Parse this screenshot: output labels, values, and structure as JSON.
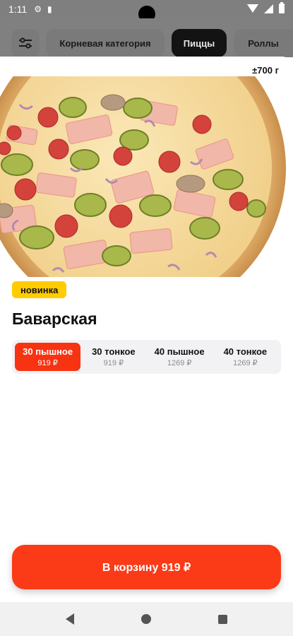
{
  "status_bar": {
    "time": "1:11",
    "icons": [
      "gear-icon",
      "sd-card-icon",
      "wifi-icon",
      "signal-icon",
      "battery-icon"
    ]
  },
  "categories": {
    "filter_icon": "sliders-icon",
    "items": [
      {
        "label": "Корневая категория",
        "active": false
      },
      {
        "label": "Пиццы",
        "active": true
      },
      {
        "label": "Роллы",
        "active": false
      }
    ]
  },
  "product": {
    "weight": "±700 г",
    "badge": "новинка",
    "name": "Баварская",
    "variants": [
      {
        "name": "30 пышное",
        "price": "919 ₽",
        "selected": true
      },
      {
        "name": "30 тонкое",
        "price": "919 ₽",
        "selected": false
      },
      {
        "name": "40 пышное",
        "price": "1269 ₽",
        "selected": false
      },
      {
        "name": "40 тонкое",
        "price": "1269 ₽",
        "selected": false
      }
    ],
    "cart_label": "В корзину 919 ₽"
  },
  "colors": {
    "accent": "#f73312",
    "badge": "#ffcc00"
  },
  "nav_bar": {
    "icons": [
      "back-icon",
      "home-icon",
      "recent-apps-icon"
    ]
  }
}
